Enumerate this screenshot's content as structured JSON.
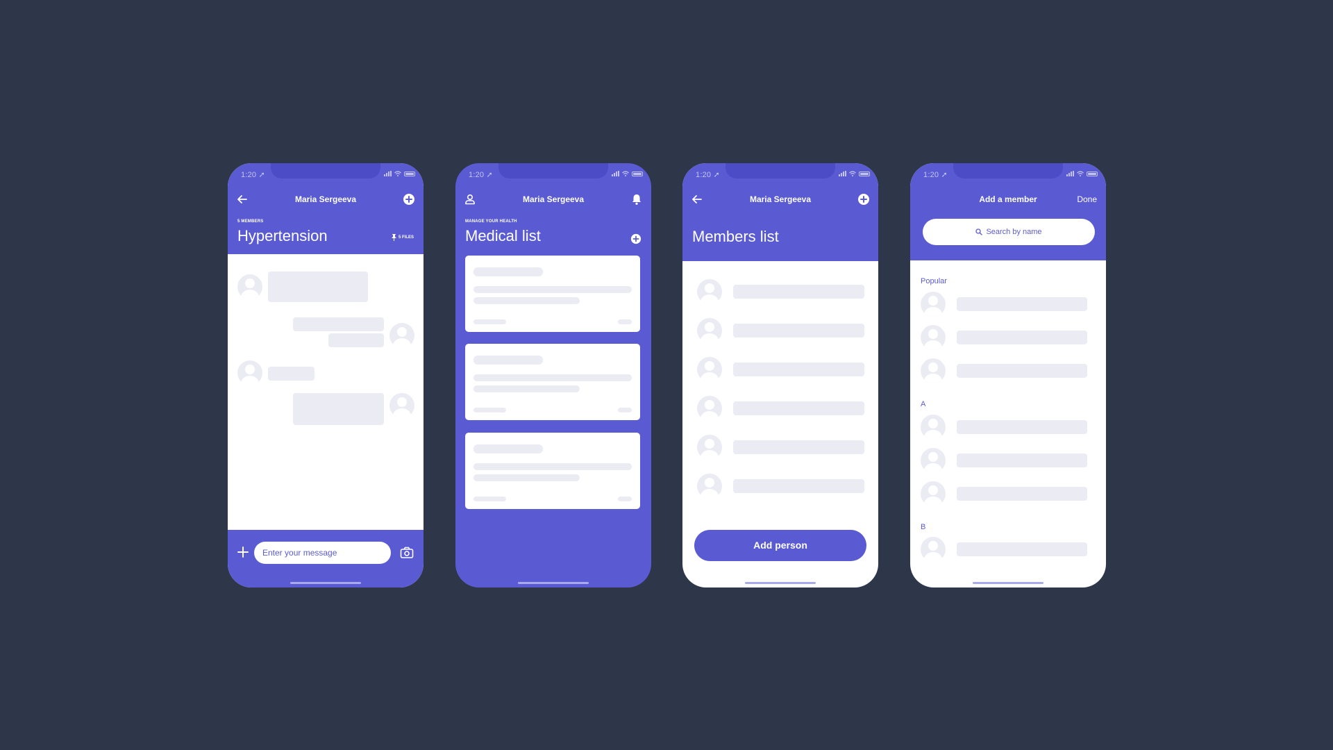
{
  "colors": {
    "background": "#2e3649",
    "brand": "#5a5bd3",
    "skeleton": "#ebebf4",
    "white": "#ffffff"
  },
  "status_bar": {
    "time": "1:20",
    "icons": [
      "location-arrow-icon",
      "signal-icon",
      "wifi-icon",
      "battery-icon"
    ]
  },
  "screens": [
    {
      "id": "chat",
      "nav": {
        "left_icon": "back-arrow-icon",
        "title": "Maria Sergeeva",
        "right_icon": "add-circle-icon"
      },
      "eyebrow": "5 MEMBERS",
      "title": "Hypertension",
      "files_label": "5 FILES",
      "files_icon": "pin-icon",
      "composer": {
        "placeholder": "Enter your message",
        "value": "",
        "left_icon": "plus-icon",
        "right_icon": "camera-icon"
      }
    },
    {
      "id": "medical-list",
      "nav": {
        "left_icon": "profile-icon",
        "title": "Maria Sergeeva",
        "right_icon": "bell-icon"
      },
      "eyebrow": "MANAGE YOUR HEALTH",
      "title": "Medical list",
      "title_action_icon": "add-circle-icon",
      "card_count": 3
    },
    {
      "id": "members-list",
      "nav": {
        "left_icon": "back-arrow-icon",
        "title": "Maria Sergeeva",
        "right_icon": "add-circle-icon"
      },
      "title": "Members list",
      "member_count": 6,
      "primary_button": "Add person"
    },
    {
      "id": "add-member",
      "nav": {
        "title": "Add a member",
        "right_label": "Done"
      },
      "search": {
        "placeholder": "Search by name",
        "icon": "search-icon"
      },
      "sections": [
        {
          "label": "Popular",
          "count": 3
        },
        {
          "label": "A",
          "count": 3
        },
        {
          "label": "B",
          "count": 1
        }
      ]
    }
  ]
}
